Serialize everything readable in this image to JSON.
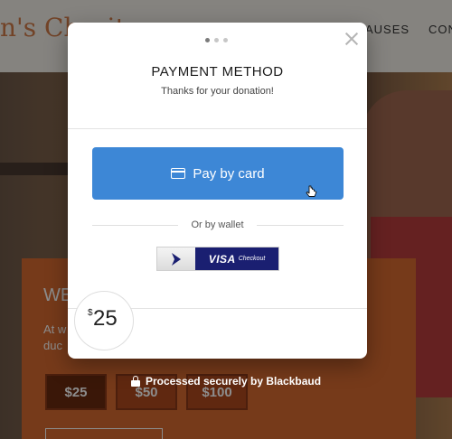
{
  "background": {
    "logo": "n's Charit",
    "nav": [
      "AUSES",
      "CON"
    ],
    "card": {
      "title": "WE",
      "text_line1": "At w",
      "text_line2": "duc",
      "amounts": [
        "$25",
        "$50",
        "$100"
      ]
    }
  },
  "modal": {
    "title": "PAYMENT METHOD",
    "subtitle": "Thanks for your donation!",
    "pay_button_label": "Pay by card",
    "wallet_divider": "Or by wallet",
    "visa_brand": "VISA",
    "visa_checkout": "Checkout",
    "currency_symbol": "$",
    "amount": "25"
  },
  "footer": {
    "secure_text": "Processed securely by Blackbaud"
  },
  "colors": {
    "pay_button": "#3d87d6",
    "visa_navy": "#1a1f71",
    "accent_orange": "#d86a30"
  },
  "icons": [
    "credit-card-icon",
    "close-icon",
    "lock-icon",
    "pointer-cursor-icon",
    "chevron-right-icon"
  ]
}
